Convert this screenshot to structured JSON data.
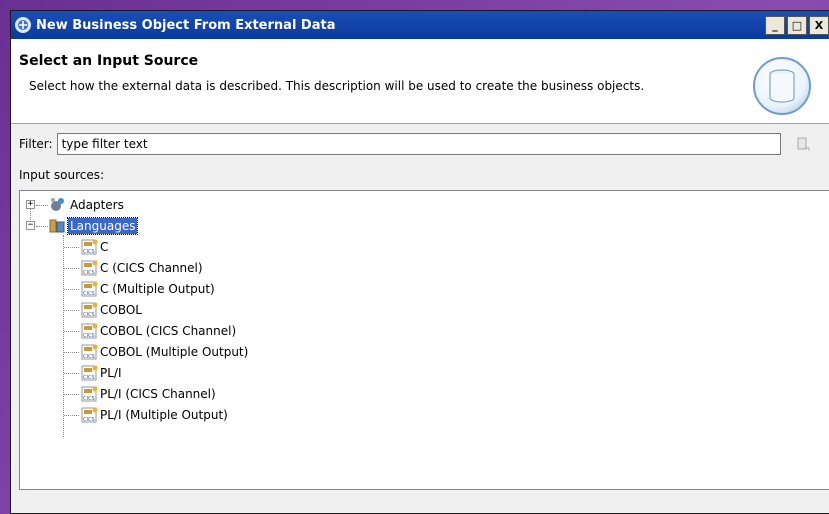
{
  "window": {
    "title": "New Business Object From External Data",
    "controls": [
      "_",
      "□",
      "X"
    ]
  },
  "header": {
    "title": "Select an Input Source",
    "description": "Select how the external data is described. This description will be used to create the business objects."
  },
  "filter": {
    "label": "Filter:",
    "value": "type filter text"
  },
  "sources": {
    "label": "Input sources:",
    "tree": [
      {
        "label": "Adapters",
        "expanded": false,
        "icon": "adapters-icon"
      },
      {
        "label": "Languages",
        "expanded": true,
        "selected": true,
        "icon": "languages-icon",
        "children": [
          "C",
          "C (CICS Channel)",
          "C (Multiple Output)",
          "COBOL",
          "COBOL (CICS Channel)",
          "COBOL (Multiple Output)",
          "PL/I",
          "PL/I (CICS Channel)",
          "PL/I (Multiple Output)"
        ]
      }
    ]
  },
  "leaf_icon_text": "CICS",
  "colors": {
    "titlebar": "#0a3a9e",
    "selection": "#3a67c8",
    "desktop": "#7a3f9e"
  }
}
